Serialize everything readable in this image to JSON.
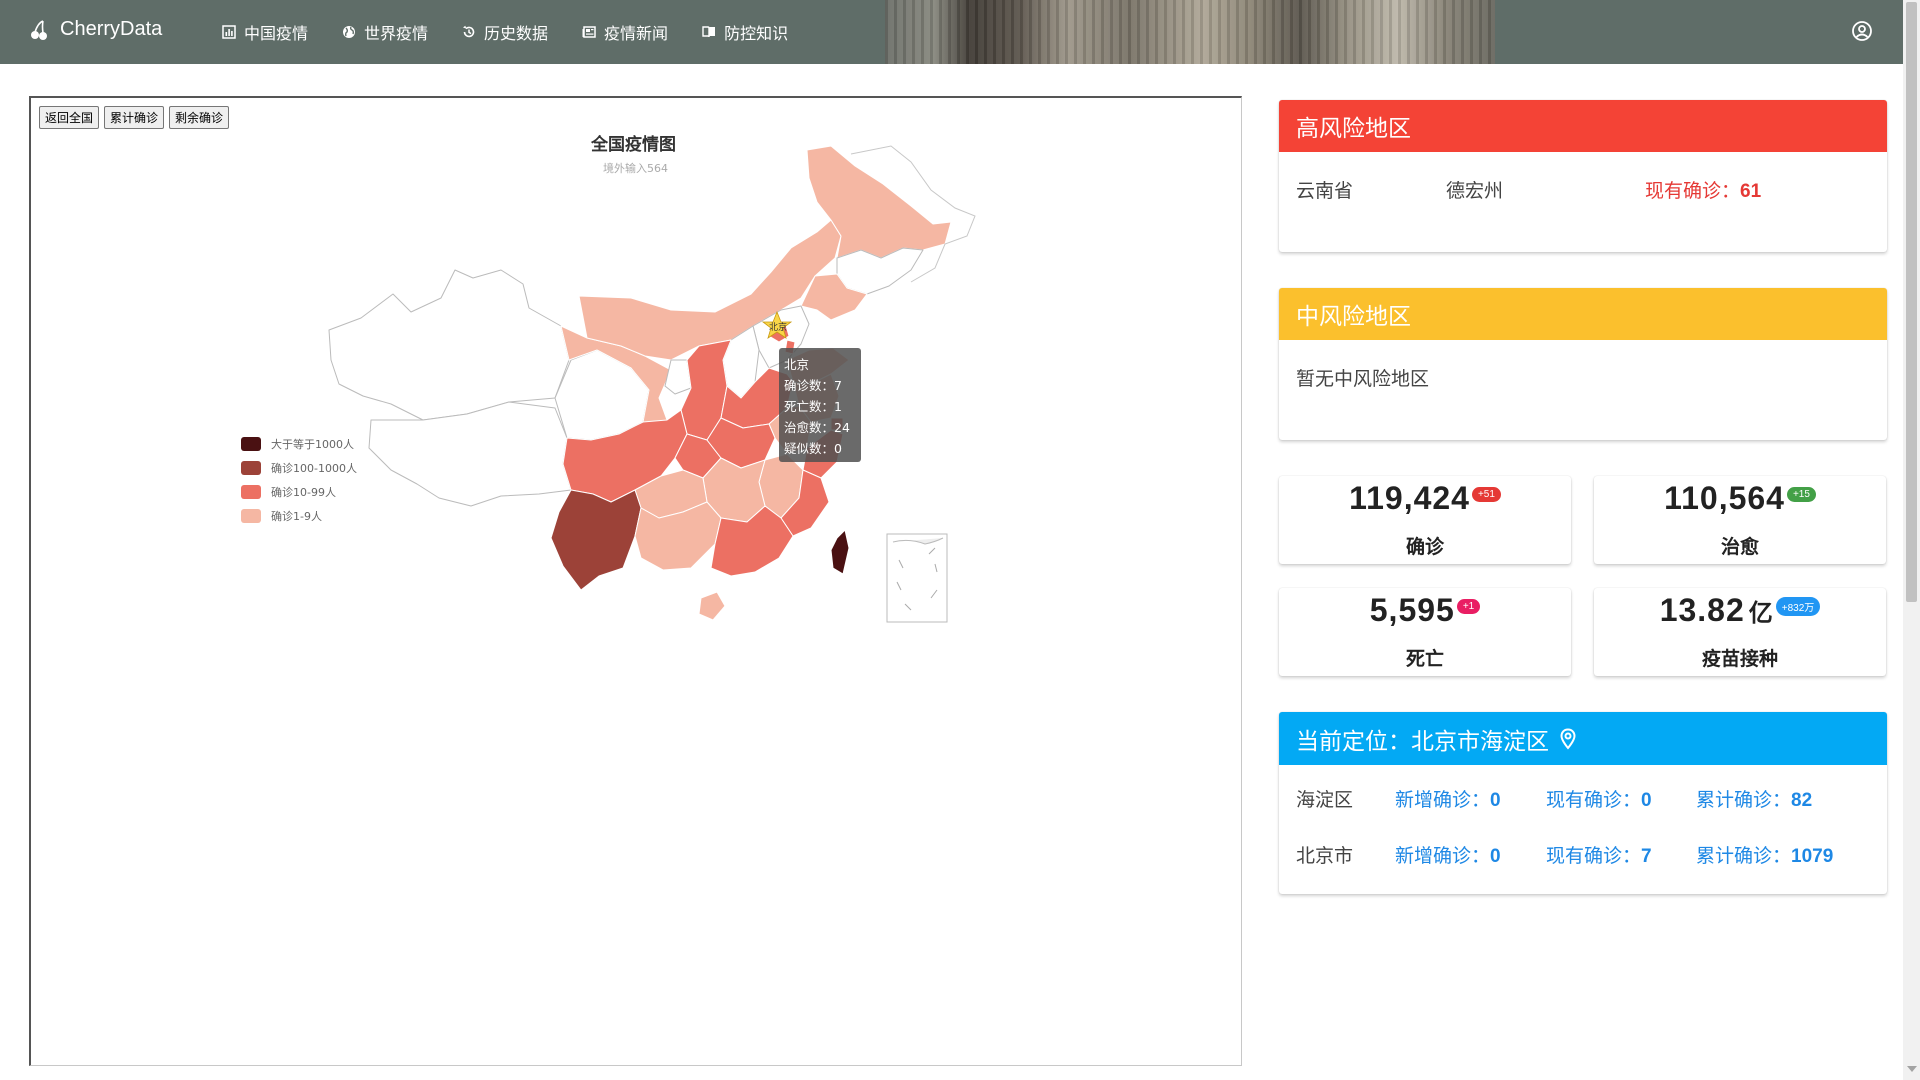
{
  "app": {
    "brand": "CherryData"
  },
  "nav": {
    "items": [
      {
        "label": "中国疫情",
        "icon": "bar-chart-icon"
      },
      {
        "label": "世界疫情",
        "icon": "globe-icon"
      },
      {
        "label": "历史数据",
        "icon": "history-icon"
      },
      {
        "label": "疫情新闻",
        "icon": "newspaper-icon"
      },
      {
        "label": "防控知识",
        "icon": "book-icon"
      }
    ],
    "user_icon": "account-circle-icon"
  },
  "map": {
    "buttons": [
      "返回全国",
      "累计确诊",
      "剩余确诊"
    ],
    "title": "全国疫情图",
    "subtitle": "境外输入564",
    "legend": [
      {
        "label": "大于等于1000人",
        "color": "#4a1112"
      },
      {
        "label": "确诊100-1000人",
        "color": "#9c4238"
      },
      {
        "label": "确诊10-99人",
        "color": "#ec7063"
      },
      {
        "label": "确诊1-9人",
        "color": "#f5b7a3"
      }
    ],
    "highlight_label": "北京",
    "tooltip": {
      "name": "北京",
      "lines": [
        "确诊数：7",
        "死亡数：1",
        "治愈数：24",
        "疑似数：0"
      ]
    }
  },
  "risk_high": {
    "title": "高风险地区",
    "province": "云南省",
    "city": "德宏州",
    "count_label": "现有确诊：",
    "count": "61"
  },
  "risk_mid": {
    "title": "中风险地区",
    "empty_text": "暂无中风险地区"
  },
  "stats": {
    "confirm": {
      "value": "119,424",
      "delta": "+51",
      "label": "确诊",
      "color": "#e53935"
    },
    "cure": {
      "value": "110,564",
      "delta": "+15",
      "label": "治愈",
      "color": "#43a047"
    },
    "death": {
      "value": "5,595",
      "delta": "+1",
      "label": "死亡",
      "color": "#e91e63"
    },
    "vaccine": {
      "value": "13.82",
      "unit": "亿",
      "delta": "+832万",
      "label": "疫苗接种",
      "color": "#2196f3"
    }
  },
  "location": {
    "title": "当前定位：北京市海淀区",
    "rows": [
      {
        "place": "海淀区",
        "new_label": "新增确诊：",
        "new": "0",
        "cur_label": "现有确诊：",
        "cur": "0",
        "total_label": "累计确诊：",
        "total": "82"
      },
      {
        "place": "北京市",
        "new_label": "新增确诊：",
        "new": "0",
        "cur_label": "现有确诊：",
        "cur": "7",
        "total_label": "累计确诊：",
        "total": "1079"
      }
    ]
  }
}
